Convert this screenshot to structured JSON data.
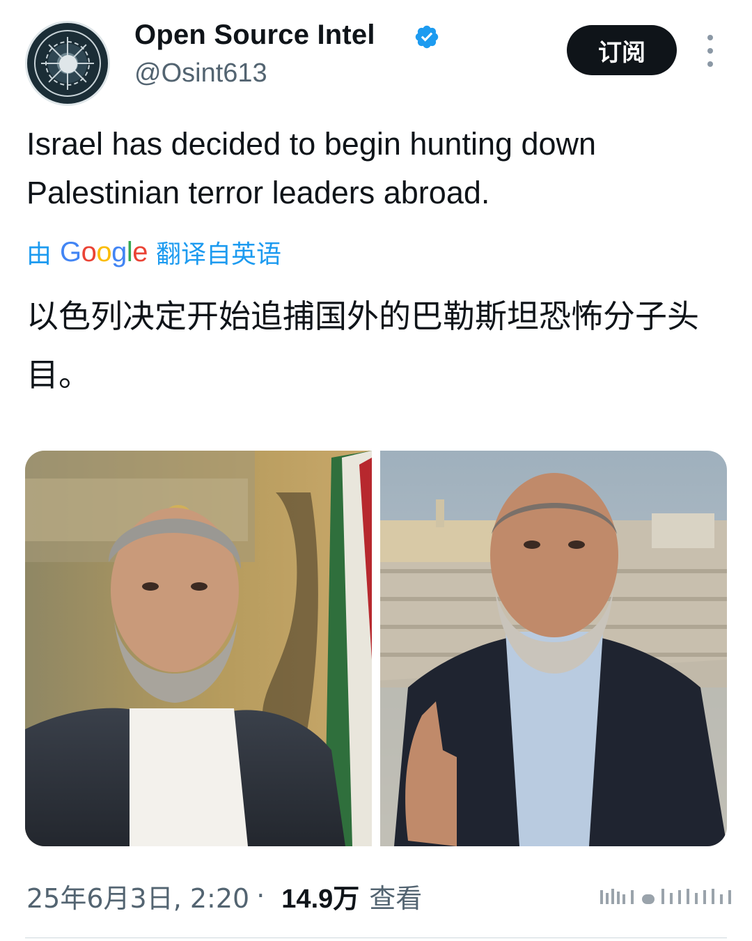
{
  "account": {
    "display_name": "Open Source Intel",
    "handle": "@Osint613",
    "avatar_icon": "osint-emblem-icon",
    "verified": true
  },
  "actions": {
    "subscribe_label": "订阅",
    "more_icon": "more-vertical-icon"
  },
  "tweet": {
    "text": "Israel has decided to begin hunting down Palestinian terror leaders abroad.",
    "translation_prefix": "由",
    "translation_brand": "Google",
    "translation_suffix": "翻译自英语",
    "translated_text": "以色列决定开始追捕国外的巴勒斯坦恐怖分子头目。"
  },
  "media": {
    "photos": [
      {
        "name": "photo-left"
      },
      {
        "name": "photo-right"
      }
    ]
  },
  "meta": {
    "timestamp": "25年6月3日, 2:20",
    "separator": "·",
    "views_count": "14.9万",
    "views_label": "查看"
  },
  "colors": {
    "text_primary": "#0f1419",
    "text_secondary": "#536471",
    "link_blue": "#1d9bf0",
    "verified_blue": "#1d9bf0",
    "button_bg": "#0f1419"
  }
}
